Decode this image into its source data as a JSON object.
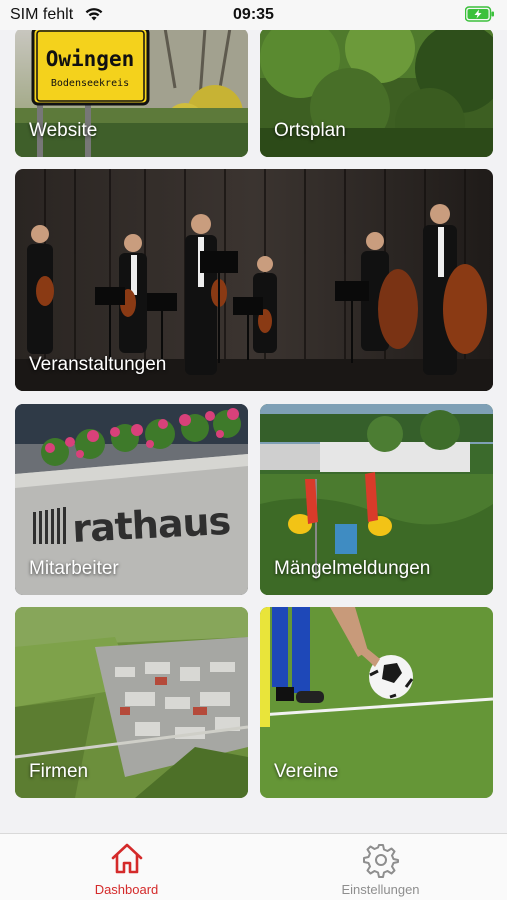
{
  "status_bar": {
    "carrier": "SIM fehlt",
    "time": "09:35"
  },
  "tiles": [
    {
      "label": "Website"
    },
    {
      "label": "Ortsplan"
    },
    {
      "label": "Veranstaltungen"
    },
    {
      "label": "Mitarbeiter"
    },
    {
      "label": "Mängelmeldungen"
    },
    {
      "label": "Firmen"
    },
    {
      "label": "Vereine"
    }
  ],
  "sign": {
    "town": "Owingen",
    "district": "Bodenseekreis"
  },
  "building_lettering": "rathaus",
  "tabbar": {
    "items": [
      {
        "label": "Dashboard",
        "icon": "home-icon",
        "active": true
      },
      {
        "label": "Einstellungen",
        "icon": "gear-icon",
        "active": false
      }
    ]
  },
  "colors": {
    "accent": "#d42a2a",
    "inactive": "#8e8e8e",
    "battery": "#3cc13c"
  }
}
